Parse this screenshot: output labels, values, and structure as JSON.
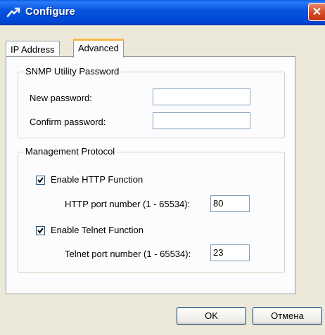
{
  "window": {
    "title": "Configure",
    "title_icon": "configure-arrow-icon",
    "close_icon": "close-x-icon",
    "close_symbol": "✕"
  },
  "tabs": [
    {
      "label": "IP Address",
      "active": false
    },
    {
      "label": "Advanced",
      "active": true
    }
  ],
  "snmp": {
    "group_title": "SNMP Utility Password",
    "new_password_label": "New password:",
    "new_password_value": "",
    "confirm_password_label": "Confirm password:",
    "confirm_password_value": ""
  },
  "management": {
    "group_title": "Management Protocol",
    "http_enable_label": "Enable HTTP Function",
    "http_enabled": true,
    "http_port_label": "HTTP port number (1 - 65534):",
    "http_port_value": "80",
    "telnet_enable_label": "Enable Telnet Function",
    "telnet_enabled": true,
    "telnet_port_label": "Telnet port number (1 - 65534):",
    "telnet_port_value": "23"
  },
  "buttons": {
    "ok_label": "OK",
    "cancel_label": "Отмена"
  },
  "colors": {
    "titlebar": "#0A5CE3",
    "dialog_bg": "#ECE9D8",
    "tab_highlight": "#F5B846",
    "close_button": "#D2441E"
  }
}
